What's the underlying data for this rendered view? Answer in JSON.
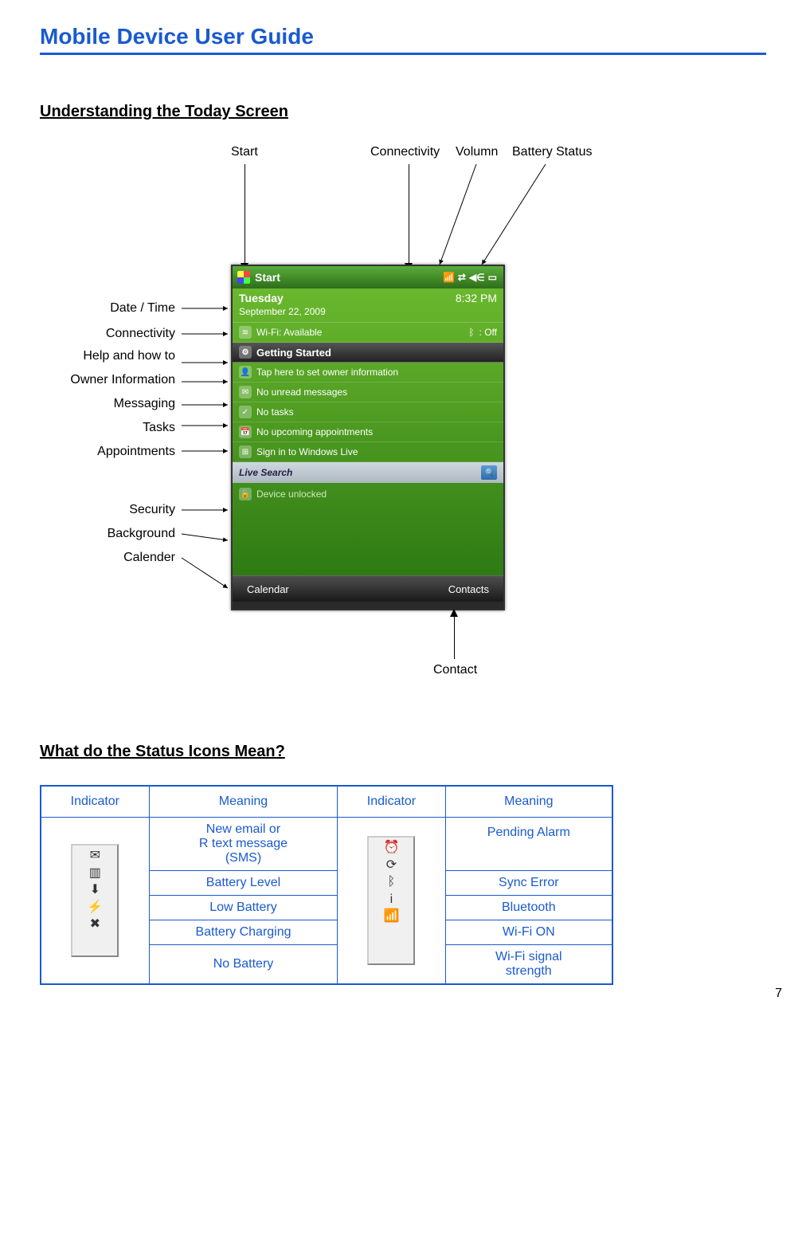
{
  "page": {
    "title": "Mobile Device User Guide",
    "section1": "Understanding the Today Screen",
    "section2": "What do the Status Icons Mean?",
    "page_number": "7"
  },
  "callouts": {
    "top": {
      "start": "Start",
      "connectivity": "Connectivity",
      "volumn": "Volumn",
      "battery": "Battery Status"
    },
    "left": {
      "datetime": "Date / Time",
      "connectivity": "Connectivity",
      "helphowto": "Help and how to",
      "owner": "Owner Information",
      "messaging": "Messaging",
      "tasks": "Tasks",
      "appointments": "Appointments",
      "security": "Security",
      "background": "Background",
      "calender": "Calender"
    },
    "bottom": {
      "contact": "Contact"
    }
  },
  "phone": {
    "start_label": "Start",
    "day": "Tuesday",
    "date": "September 22, 2009",
    "time": "8:32 PM",
    "wifi": "Wi-Fi: Available",
    "bt_off": ": Off",
    "getting_started": "Getting Started",
    "owner_info": "Tap here to set owner information",
    "messages": "No unread messages",
    "tasks": "No tasks",
    "appointments": "No upcoming appointments",
    "windows_live": "Sign in to Windows Live",
    "live_search": "Live Search",
    "device_unlocked": "Device unlocked",
    "softkey_left": "Calendar",
    "softkey_right": "Contacts"
  },
  "table": {
    "headers": [
      "Indicator",
      "Meaning",
      "Indicator",
      "Meaning"
    ],
    "left_meanings": {
      "new_email": "New email or",
      "r_text": "R text message",
      "sms": "(SMS)",
      "battery_level": "Battery Level",
      "low_battery": "Low Battery",
      "battery_charging": "Battery Charging",
      "no_battery": "No Battery"
    },
    "right_meanings": {
      "pending_alarm": "Pending Alarm",
      "sync_error": "Sync Error",
      "bluetooth": "Bluetooth",
      "wifi_on": "Wi-Fi ON",
      "wifi_signal": "Wi-Fi signal",
      "strength": "strength"
    }
  }
}
